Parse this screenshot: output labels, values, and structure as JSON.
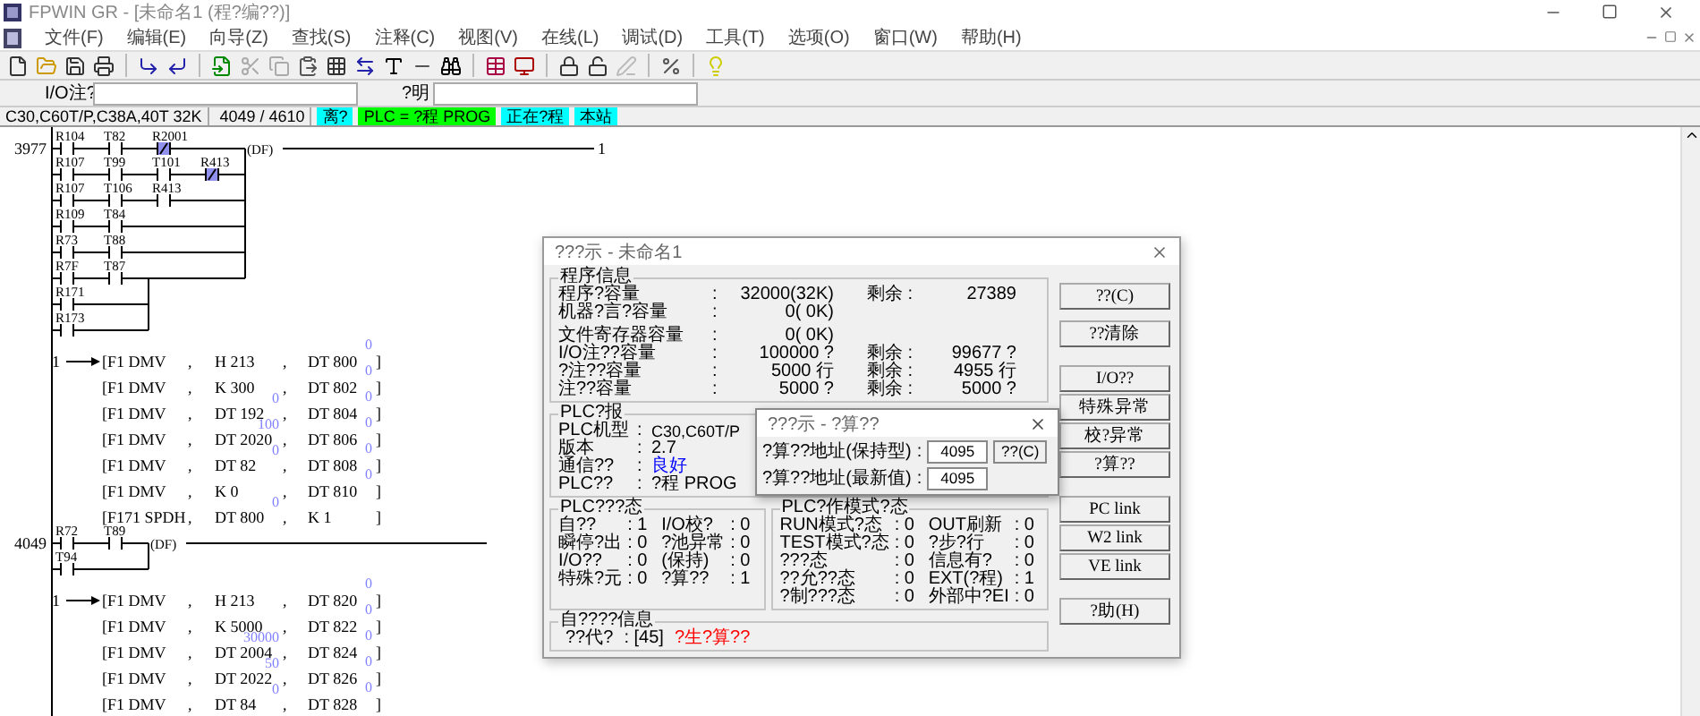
{
  "window": {
    "title": "FPWIN GR - [未命名1 (程?编??)]"
  },
  "menu": [
    "文件(F)",
    "编辑(E)",
    "向导(Z)",
    "查找(S)",
    "注释(C)",
    "视图(V)",
    "在线(L)",
    "调试(D)",
    "工具(T)",
    "选项(O)",
    "窗口(W)",
    "帮助(H)"
  ],
  "comment_bar": {
    "io_label": "I/O注?",
    "desc_label": "?明"
  },
  "status_bar": [
    {
      "text": "C30,C60T/P,C38A,40T 32K"
    },
    {
      "text": "4049 / 4610"
    },
    {
      "text": "离?",
      "color": "#00ffff"
    },
    {
      "text": "PLC = ?程 PROG",
      "color": "#00ff00"
    },
    {
      "text": "正在?程",
      "color": "#00ffff"
    },
    {
      "text": "本站",
      "color": "#00ffff"
    }
  ],
  "ladder": [
    {
      "kind": "rung",
      "number": "3977",
      "coil": "(DF)",
      "output_marker": "1",
      "rows": [
        {
          "kind": "outer",
          "contacts": [
            {
              "label": "R104",
              "kind": "no"
            },
            {
              "label": "T82",
              "kind": "no"
            },
            {
              "label": "R2001",
              "kind": "nc"
            }
          ]
        },
        {
          "kind": "outer",
          "contacts": [
            {
              "label": "R107",
              "kind": "no"
            },
            {
              "label": "T99",
              "kind": "no"
            },
            {
              "label": "T101",
              "kind": "no"
            },
            {
              "label": "R413",
              "kind": "nc"
            }
          ]
        },
        {
          "kind": "outer",
          "contacts": [
            {
              "label": "R107",
              "kind": "no"
            },
            {
              "label": "T106",
              "kind": "no"
            },
            {
              "label": "R413",
              "kind": "no"
            }
          ]
        },
        {
          "kind": "outer",
          "contacts": [
            {
              "label": "R109",
              "kind": "no"
            },
            {
              "label": "T84",
              "kind": "no"
            }
          ]
        },
        {
          "kind": "outer",
          "contacts": [
            {
              "label": "R73",
              "kind": "no"
            },
            {
              "label": "T88",
              "kind": "no"
            }
          ]
        },
        {
          "kind": "outer",
          "contacts": [
            {
              "label": "R7F",
              "kind": "no"
            },
            {
              "label": "T87",
              "kind": "no"
            }
          ]
        },
        {
          "kind": "inner",
          "contacts": [
            {
              "label": "R171",
              "kind": "no"
            }
          ]
        },
        {
          "kind": "inner",
          "contacts": [
            {
              "label": "R173",
              "kind": "no"
            }
          ]
        }
      ]
    },
    {
      "kind": "block",
      "rows": [
        {
          "marker": "1",
          "op": "[F1 DMV",
          "sep1": ",",
          "src": "H 213",
          "sep2": ",",
          "dst": "DT 800",
          "dst_value": "0",
          "close": "]"
        },
        {
          "op": "[F1 DMV",
          "sep1": ",",
          "src": "K 300",
          "sep2": ",",
          "dst": "DT 802",
          "dst_value": "0",
          "close": "]"
        },
        {
          "op": "[F1 DMV",
          "sep1": ",",
          "src": "DT 192",
          "src_value": "0",
          "sep2": ",",
          "dst": "DT 804",
          "dst_value": "0",
          "close": "]"
        },
        {
          "op": "[F1 DMV",
          "sep1": ",",
          "src": "DT 2020",
          "src_value": "100",
          "sep2": ",",
          "dst": "DT 806",
          "dst_value": "0",
          "close": "]"
        },
        {
          "op": "[F1 DMV",
          "sep1": ",",
          "src": "DT 82",
          "src_value": "0",
          "sep2": ",",
          "dst": "DT 808",
          "dst_value": "0",
          "close": "]"
        },
        {
          "op": "[F1 DMV",
          "sep1": ",",
          "src": "K 0",
          "sep2": ",",
          "dst": "DT 810",
          "dst_value": "0",
          "close": "]"
        },
        {
          "op": "[F171 SPDH",
          "sep1": ",",
          "src": "DT 800",
          "src_value": "0",
          "sep2": ",",
          "dst": "K 1",
          "close": "]"
        }
      ]
    },
    {
      "kind": "rung",
      "number": "4049",
      "coil": "(DF)",
      "rows": [
        {
          "kind": "outer",
          "contacts": [
            {
              "label": "R72",
              "kind": "no"
            },
            {
              "label": "T89",
              "kind": "no"
            }
          ]
        },
        {
          "kind": "inner",
          "contacts": [
            {
              "label": "T94",
              "kind": "no"
            }
          ]
        }
      ]
    },
    {
      "kind": "block",
      "rows": [
        {
          "marker": "1",
          "op": "[F1 DMV",
          "sep1": ",",
          "src": "H 213",
          "sep2": ",",
          "dst": "DT 820",
          "dst_value": "0",
          "close": "]"
        },
        {
          "op": "[F1 DMV",
          "sep1": ",",
          "src": "K 5000",
          "sep2": ",",
          "dst": "DT 822",
          "dst_value": "0",
          "close": "]"
        },
        {
          "op": "[F1 DMV",
          "sep1": ",",
          "src": "DT 2004",
          "src_value": "30000",
          "sep2": ",",
          "dst": "DT 824",
          "dst_value": "0",
          "close": "]"
        },
        {
          "op": "[F1 DMV",
          "sep1": ",",
          "src": "DT 2022",
          "src_value": "50",
          "sep2": ",",
          "dst": "DT 826",
          "dst_value": "0",
          "close": "]"
        },
        {
          "op": "[F1 DMV",
          "sep1": ",",
          "src": "DT 84",
          "src_value": "0",
          "sep2": ",",
          "dst": "DT 828",
          "dst_value": "0",
          "close": "]"
        }
      ]
    }
  ],
  "dialog": {
    "title": "???示 - 未命名1",
    "program_info": {
      "title": "程序信息",
      "sections": [
        [
          {
            "label": "程序?容量",
            "sep": ":",
            "value": "32000(32K)",
            "remain_label": "剩余 :",
            "remain_value": "27389"
          },
          {
            "label": "机器?言?容量",
            "sep": ":",
            "value": "0( 0K)"
          }
        ],
        [
          {
            "label": "文件寄存器容量",
            "sep": ":",
            "value": "0( 0K)"
          },
          {
            "label": "I/O注??容量",
            "sep": ":",
            "value": "100000 ?",
            "remain_label": "剩余 :",
            "remain_value": "99677 ?"
          },
          {
            "label": "?注??容量",
            "sep": ":",
            "value": "5000 行",
            "remain_label": "剩余 :",
            "remain_value": "4955 行"
          },
          {
            "label": "注??容量",
            "sep": ":",
            "value": "5000 ?",
            "remain_label": "剩余 :",
            "remain_value": "5000 ?"
          }
        ]
      ]
    },
    "plc_info": {
      "title": "PLC?报",
      "rows": [
        {
          "label": "PLC机型",
          "sep": ":",
          "value": "C30,C60T/P"
        },
        {
          "label": "版本",
          "sep": ":",
          "value": "2.7"
        },
        {
          "label": "通信??",
          "sep": ":",
          "value": "良好",
          "color": "#0000ff"
        },
        {
          "label": "PLC??",
          "sep": ":",
          "value": "?程 PROG"
        }
      ]
    },
    "plc_status": {
      "title": "PLC???态",
      "rows": [
        {
          "label": "自??",
          "value": ": 1",
          "label2": "I/O校?",
          "value2": ": 0"
        },
        {
          "label": "瞬停?出",
          "value": ": 0",
          "label2": "?池异常",
          "value2": ": 0"
        },
        {
          "label": "I/O??",
          "value": ": 0",
          "label2": "(保持)",
          "value2": ": 0"
        },
        {
          "label": "特殊?元",
          "value": ": 0",
          "label2": "?算??",
          "value2": ": 1"
        }
      ]
    },
    "mode_status": {
      "title": "PLC?作模式?态",
      "rows": [
        {
          "label": "RUN模式?态",
          "value": ": 0",
          "label2": "OUT刷新",
          "value2": ": 0"
        },
        {
          "label": "TEST模式?态",
          "value": ": 0",
          "label2": "?步?行",
          "value2": ": 0"
        },
        {
          "label": "???态",
          "value": ": 0",
          "label2": "信息有?",
          "value2": ": 0"
        },
        {
          "label": "??允??态",
          "value": ": 0",
          "label2": "EXT(?程)",
          "value2": ": 1"
        },
        {
          "label": "?制???态",
          "value": ": 0",
          "label2": "外部中?EI",
          "value2": ": 0"
        }
      ]
    },
    "error_info": {
      "title": "自????信息",
      "label": "??代?",
      "value": ": [45]",
      "message": "?生?算??",
      "color": "#ff0000"
    },
    "buttons": [
      [
        "??(C)",
        "??清除"
      ],
      [
        "I/O??",
        "特殊异常",
        "校?异常",
        "?算??"
      ],
      [
        "PC link",
        "W2 link",
        "VE link"
      ],
      [
        "?助(H)"
      ]
    ],
    "subdialog": {
      "title": "???示 - ?算??",
      "rows": [
        {
          "label": "?算??地址(保持型)",
          "sep": ":",
          "value": "4095",
          "button": "??(C)"
        },
        {
          "label": "?算??地址(最新值)",
          "sep": ":",
          "value": "4095"
        }
      ]
    }
  }
}
